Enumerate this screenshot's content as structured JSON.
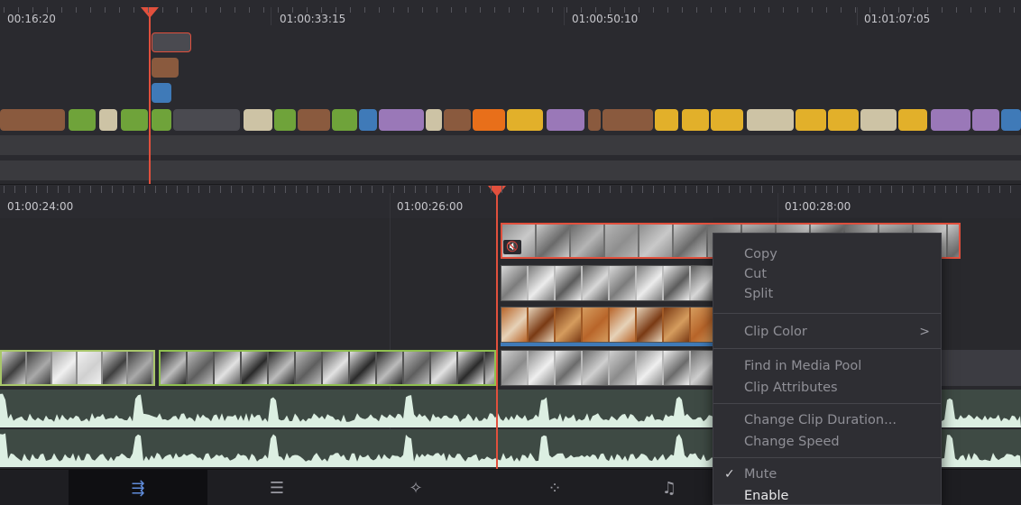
{
  "upper_timeline": {
    "timecodes": [
      "00:16:20",
      "01:00:33:15",
      "01:00:50:10",
      "01:01:07:05"
    ]
  },
  "lower_timeline": {
    "timecodes": [
      "01:00:24:00",
      "01:00:26:00",
      "01:00:28:00"
    ]
  },
  "clip_icons": {
    "mute_symbol": "🔇"
  },
  "toolbar": {
    "buttons": [
      {
        "name": "cut-page-icon",
        "glyph": "⇶",
        "active": true
      },
      {
        "name": "edit-page-icon",
        "glyph": "☰",
        "active": false
      },
      {
        "name": "fusion-page-icon",
        "glyph": "✧",
        "active": false
      },
      {
        "name": "color-page-icon",
        "glyph": "⁘",
        "active": false
      },
      {
        "name": "fairlight-page-icon",
        "glyph": "♫",
        "active": false
      }
    ]
  },
  "context_menu": {
    "copy": "Copy",
    "cut": "Cut",
    "split": "Split",
    "clip_color": "Clip Color",
    "clip_color_arrow": ">",
    "find_in_media_pool": "Find in Media Pool",
    "clip_attributes": "Clip Attributes",
    "change_clip_duration": "Change Clip Duration...",
    "change_speed": "Change Speed",
    "mute_check": "✓",
    "mute": "Mute",
    "enable": "Enable"
  },
  "colors": {
    "playhead": "#e1503d",
    "clip_green": "#6fa33a",
    "clip_orange": "#e86f1a",
    "clip_yellow": "#e2b02a",
    "clip_purple": "#9a78b8",
    "clip_beige": "#cdc3a5",
    "clip_brown": "#8a5a3e",
    "clip_blue": "#3f7ab8"
  }
}
